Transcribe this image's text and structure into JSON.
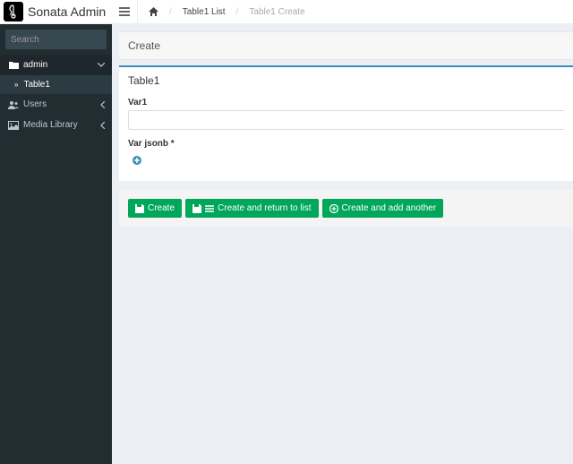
{
  "brand": {
    "name": "Sonata Admin"
  },
  "search": {
    "placeholder": "Search"
  },
  "sidebar": {
    "items": [
      {
        "label": "admin",
        "icon": "folder-icon",
        "open": true,
        "children": [
          {
            "label": "Table1",
            "active": true
          }
        ]
      },
      {
        "label": "Users",
        "icon": "users-icon"
      },
      {
        "label": "Media Library",
        "icon": "image-icon"
      }
    ]
  },
  "breadcrumb": {
    "home": "Home",
    "items": [
      "Table1 List",
      "Table1 Create"
    ]
  },
  "page": {
    "header": "Create",
    "box_title": "Table1",
    "fields": {
      "var1_label": "Var1",
      "jsonb_label": "Var jsonb *"
    },
    "buttons": {
      "create": "Create",
      "create_list": "Create and return to list",
      "create_another": "Create and add another"
    }
  }
}
